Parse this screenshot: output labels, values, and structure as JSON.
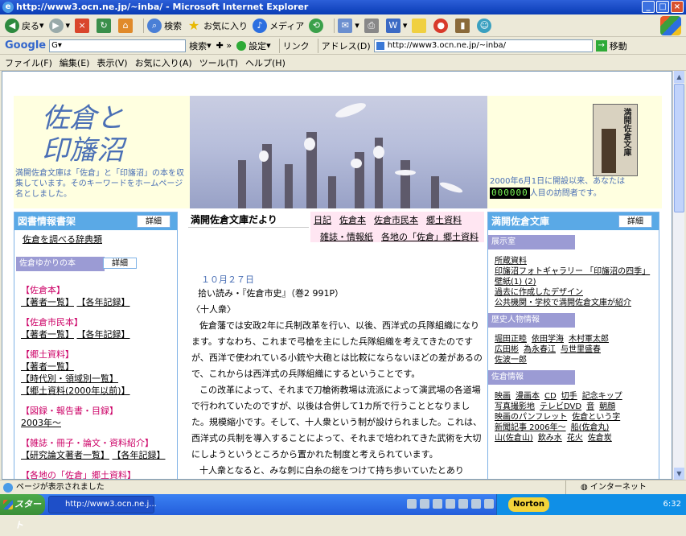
{
  "window": {
    "title": "http://www3.ocn.ne.jp/~inba/ - Microsoft Internet Explorer"
  },
  "toolbar": {
    "back": "戻る",
    "search": "検索",
    "favorites": "お気に入り",
    "media": "メディア"
  },
  "googlebar": {
    "brand": "Google",
    "search_btn": "検索",
    "settings": "設定",
    "links": "リンク",
    "address_label": "アドレス(D)",
    "address": "http://www3.ocn.ne.jp/~inba/",
    "go": "移動"
  },
  "menu": [
    "ファイル(F)",
    "編集(E)",
    "表示(V)",
    "お気に入り(A)",
    "ツール(T)",
    "ヘルプ(H)"
  ],
  "page": {
    "logo_line1": "佐倉と",
    "logo_line2": "印旛沼",
    "intro": "満開佐倉文庫は「佐倉」と「印旛沼」の本を収集しています。そのキーワードをホームページ名としました。",
    "book_title": "満開佐倉文庫",
    "visit_pre": "2000年6月1日に開設以来、あなたは",
    "counter": "000000",
    "visit_post": "人目の訪問者です。",
    "left": {
      "title": "図書情報書架",
      "detail": "詳細",
      "dict": "佐倉を調べる辞典類",
      "sub": "佐倉ゆかりの本",
      "s1": "【佐倉本】",
      "s1a": "【著者一覧】",
      "s1b": "【各年記録】",
      "s2": "【佐倉市民本】",
      "s2a": "【著者一覧】",
      "s2b": "【各年記録】",
      "s3": "【郷土資料】",
      "s3a": "【著者一覧】",
      "s3b": "【時代別・領域別一覧】",
      "s3c": "【郷土資料(2000年以前)】",
      "s4": "【図録・報告書・目録】",
      "s4a": "2003年〜",
      "s5": "【雑誌・冊子・論文・資料紹介】",
      "s5a": "【研究論文著者一覧】",
      "s5b": "【各年記録】",
      "s6": "【各地の「佐倉」郷土資料】"
    },
    "mid": {
      "title": "満開佐倉文庫だより",
      "nav1": [
        "日記",
        "佐倉本",
        "佐倉市民本",
        "郷土資料"
      ],
      "nav2": [
        "雑誌・情報紙",
        "各地の「佐倉」郷土資料"
      ],
      "date": "１０月２７日",
      "p1": "拾い読み・『佐倉市史』（巻2 991P）",
      "p2": "〈十人衆〉",
      "p3": "佐倉藩では安政2年に兵制改革を行い、以後、西洋式の兵隊組織になります。すなわち、これまで弓槍を主にした兵隊組織を考えてきたのですが、西洋で使われている小銃や大砲とは比較にならないほどの差があるので、これからは西洋式の兵隊組織にするということです。",
      "p4": "この改革によって、それまで刀槍術教場は流派によって演武場の各道場で行われていたのですが、以後は合併して1カ所で行うこととなりました。規模縮小です。そして、十人衆という制が設けられました。これは、西洋式の兵制を導入することによって、それまで培われてきた武術を大切にしようというところから置かれた制度と考えられています。",
      "p5": "十人衆となると、みな刺に白糸の総をつけて持ち歩いていたとあり"
    },
    "right": {
      "title": "満開佐倉文庫",
      "detail": "詳細",
      "h1": "展示室",
      "l1": [
        "所蔵資料",
        "印旛沼フォトギャラリー 「印旛沼の四季」",
        "壁紙(1) (2)",
        "過去に作成したデザイン",
        "公共機関・学校で満開佐倉文庫が紹介"
      ],
      "h2": "歴史人物情報",
      "l2": [
        "堀田正睦",
        "依田学海",
        "木村軍太郎",
        "広田彬",
        "為永春江",
        "与世里盛春",
        "佐波一郎"
      ],
      "h3": "佐倉情報",
      "l3": [
        "映画",
        "漫画本",
        "CD",
        "切手",
        "記念キップ",
        "写真撮影地",
        "テレビDVD",
        "音",
        "朝顔",
        "映画のパンフレット",
        "佐倉という字",
        "新聞記事 2006年〜",
        "船(佐倉丸)",
        "山(佐倉山)",
        "飲み水",
        "花火",
        "佐倉炭"
      ]
    }
  },
  "status": {
    "text": "ページが表示されました",
    "zone": "インターネット"
  },
  "taskbar": {
    "start": "スタート",
    "task": "http://www3.ocn.ne.j...",
    "norton": "Norton",
    "clock": "6:32"
  }
}
